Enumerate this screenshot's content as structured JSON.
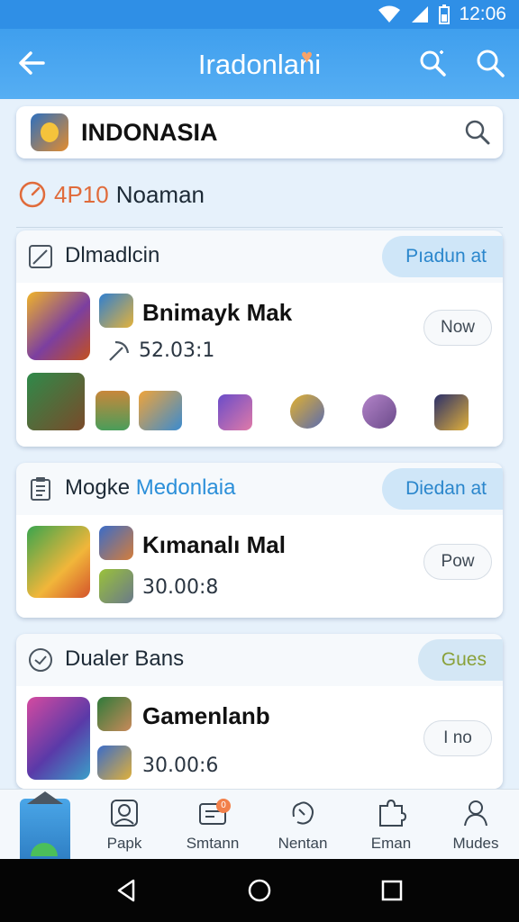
{
  "status_bar": {
    "time": "12:06"
  },
  "app_bar": {
    "title": "Iradonlani"
  },
  "search": {
    "value": "INDONASIA"
  },
  "section": {
    "number": "4P10",
    "label": "Noaman"
  },
  "cards": [
    {
      "header": "Dlmadlcin",
      "header_accent": "",
      "pill": "Pıadun at",
      "game_title": "Bnimayk Mak",
      "game_meta": "52.03:1",
      "button": "Now"
    },
    {
      "header": "Mogke",
      "header_accent": "Medonlaia",
      "pill": "Diedan at",
      "game_title": "Kımanalı Mal",
      "game_meta": "30.00:8",
      "button": "Pow"
    },
    {
      "header": "Dualer Bans",
      "header_accent": "",
      "pill": "Gues",
      "game_title": "Gamenlanb",
      "game_meta": "30.00:6",
      "button": "I no"
    }
  ],
  "bottom_nav": [
    {
      "label": "",
      "icon": "home-icon"
    },
    {
      "label": "Papk",
      "icon": "profile-icon"
    },
    {
      "label": "Smtann",
      "icon": "store-icon",
      "badge": "0"
    },
    {
      "label": "Nentan",
      "icon": "hand-icon"
    },
    {
      "label": "Eman",
      "icon": "puzzle-icon"
    },
    {
      "label": "Mudes",
      "icon": "user-icon"
    }
  ],
  "colors": {
    "primary": "#3f9fee",
    "accent": "#2b8fd9",
    "orange": "#e06b3b"
  }
}
